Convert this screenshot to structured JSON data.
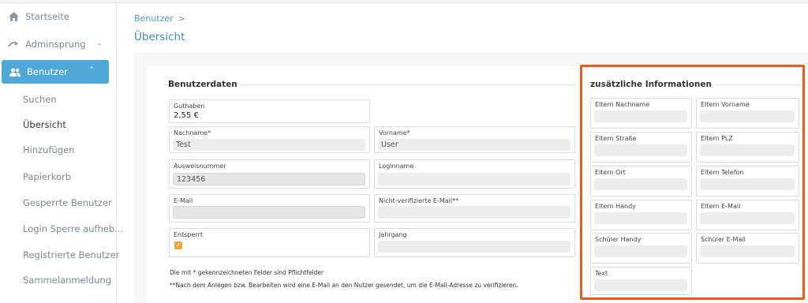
{
  "sidebar": {
    "items": [
      {
        "label": "Startseite",
        "icon": "home-icon"
      },
      {
        "label": "Adminsprung",
        "icon": "jump-arrow-icon"
      },
      {
        "label": "Benutzer",
        "icon": "users-icon"
      }
    ],
    "sub_items": [
      {
        "label": "Suchen"
      },
      {
        "label": "Übersicht"
      },
      {
        "label": "Hinzufügen"
      },
      {
        "label": "Papierkorb"
      },
      {
        "label": "Gesperrte Benutzer"
      },
      {
        "label": "Login Sperre aufheb..."
      },
      {
        "label": "Registrierte Benutzer"
      },
      {
        "label": "Sammelanmeldung"
      }
    ]
  },
  "breadcrumb": {
    "item": "Benutzer",
    "sep": ">"
  },
  "page_title": "Übersicht",
  "benutzerdaten": {
    "legend": "Benutzerdaten",
    "guthaben": {
      "label": "Guthaben",
      "value": "2,55 €"
    },
    "nachname": {
      "label": "Nachname*",
      "value": "Test"
    },
    "vorname": {
      "label": "Vorname*",
      "value": "User"
    },
    "ausweisnummer": {
      "label": "Ausweisnummer",
      "value": "123456"
    },
    "loginname": {
      "label": "Loginname",
      "value": ""
    },
    "email": {
      "label": "E-Mail",
      "value": ""
    },
    "nicht_verifiziert": {
      "label": "Nicht-verifizierte E-Mail**",
      "value": ""
    },
    "entsperrt": {
      "label": "Entsperrt",
      "checked": true,
      "check": "✓"
    },
    "jahrgang": {
      "label": "Jahrgang",
      "value": ""
    },
    "note1": "Die mit * gekennzeichneten Felder sind Pflichtfelder",
    "note2": "**Nach dem Anlegen bzw. Bearbeiten wird eine E-Mail an den Nutzer gesendet, um die E-Mail-Adresse zu verifizieren."
  },
  "zusatz": {
    "legend": "zusätzliche Informationen",
    "fields": [
      {
        "label": "Eltern Nachname"
      },
      {
        "label": "Eltern Vorname"
      },
      {
        "label": "Eltern Straße"
      },
      {
        "label": "Eltern PLZ"
      },
      {
        "label": "Eltern Ort"
      },
      {
        "label": "Eltern Telefon"
      },
      {
        "label": "Eltern Handy"
      },
      {
        "label": "Eltern E-Mail"
      },
      {
        "label": "Schüler Handy"
      },
      {
        "label": "Schüler E-Mail"
      },
      {
        "label": "Text"
      }
    ]
  },
  "colors": {
    "accent": "#4fa8d8",
    "highlight": "#f05a19",
    "checkbox": "#f0a23b"
  }
}
